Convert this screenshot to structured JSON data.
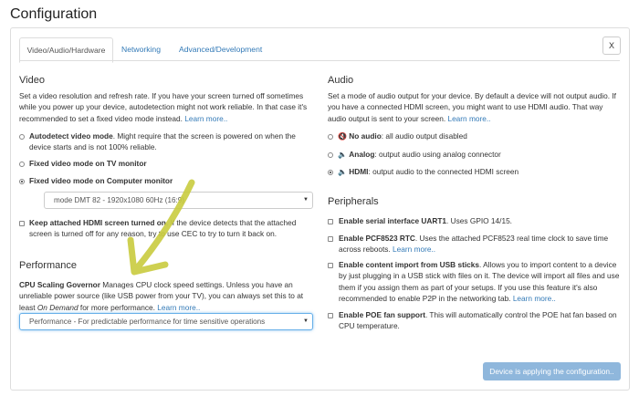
{
  "page": {
    "title": "Configuration"
  },
  "tabs": [
    {
      "label": "Video/Audio/Hardware",
      "active": true
    },
    {
      "label": "Networking",
      "active": false
    },
    {
      "label": "Advanced/Development",
      "active": false
    }
  ],
  "close_label": "X",
  "video": {
    "heading": "Video",
    "desc": "Set a video resolution and refresh rate. If you have your screen turned off sometimes while you power up your device, autodetection might not work reliable. In that case it's recommended to set a fixed video mode instead.",
    "learn_more": "Learn more..",
    "options": [
      {
        "bold": "Autodetect video mode",
        "text": ". Might require that the screen is powered on when the device starts and is not 100% reliable.",
        "selected": false
      },
      {
        "bold": "Fixed video mode on TV monitor",
        "text": "",
        "selected": false
      },
      {
        "bold": "Fixed video mode on Computer monitor",
        "text": "",
        "selected": true
      }
    ],
    "mode_select": "mode DMT 82 - 1920x1080 60Hz (16:9)",
    "hdmi_check": {
      "bold": "Keep attached HDMI screen turned on",
      "text": ". If the device detects that the attached screen is turned off for any reason, try to use CEC to try to turn it back on.",
      "checked": false
    }
  },
  "performance": {
    "heading": "Performance",
    "bold": "CPU Scaling Governor",
    "text1": " Manages CPU clock speed settings. Unless you have an unreliable power source (like USB power from your TV), you can always set this to at least ",
    "em": "On Demand",
    "text2": " for more performance.",
    "learn_more": "Learn more..",
    "select": "Performance - For predictable performance for time sensitive operations"
  },
  "audio": {
    "heading": "Audio",
    "desc": "Set a mode of audio output for your device. By default a device will not output audio. If you have a connected HDMI screen, you might want to use HDMI audio. That way audio output is sent to your screen.",
    "learn_more": "Learn more..",
    "options": [
      {
        "bold": "No audio",
        "text": ": all audio output disabled",
        "icon": "speaker-muted-icon",
        "selected": false
      },
      {
        "bold": "Analog",
        "text": ": output audio using analog connector",
        "icon": "speaker-icon",
        "selected": false
      },
      {
        "bold": "HDMI",
        "text": ": output audio to the connected HDMI screen",
        "icon": "speaker-icon",
        "selected": true
      }
    ]
  },
  "peripherals": {
    "heading": "Peripherals",
    "items": [
      {
        "bold": "Enable serial interface UART1",
        "text": ". Uses GPIO 14/15.",
        "learn_more": "",
        "checked": false
      },
      {
        "bold": "Enable PCF8523 RTC",
        "text": ". Uses the attached PCF8523 real time clock to save time across reboots.",
        "learn_more": "Learn more..",
        "checked": false
      },
      {
        "bold": "Enable content import from USB sticks",
        "text": ". Allows you to import content to a device by just plugging in a USB stick with files on it. The device will import all files and use them if you assign them as part of your setups. If you use this feature it's also recommended to enable P2P in the networking tab.",
        "learn_more": "Learn more..",
        "checked": false
      },
      {
        "bold": "Enable POE fan support",
        "text": ". This will automatically control the POE hat fan based on CPU temperature.",
        "learn_more": "",
        "checked": false
      }
    ]
  },
  "apply_button": "Device is applying the configuration..",
  "colors": {
    "link": "#337ab7",
    "apply_bg": "#8fb7dc",
    "annotation_arrow": "#c9cc3f"
  }
}
